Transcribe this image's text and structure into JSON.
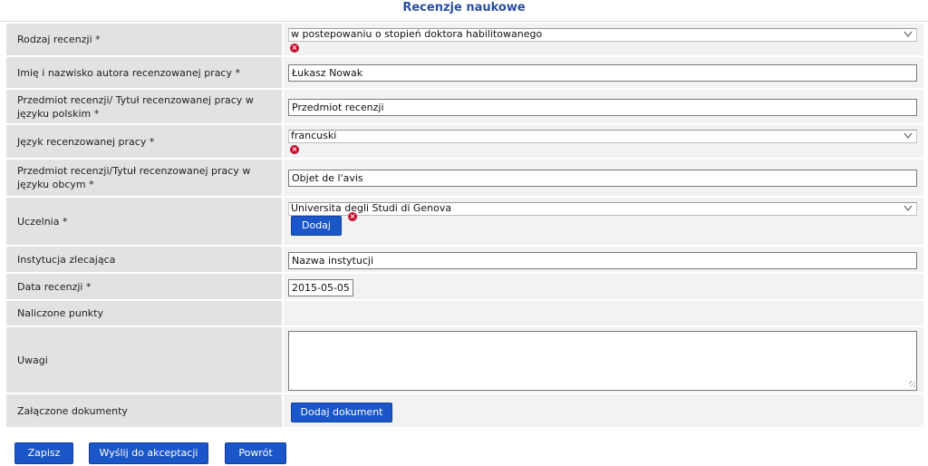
{
  "page": {
    "title": "Recenzje naukowe"
  },
  "form": {
    "review_type": {
      "label": "Rodzaj recenzji *",
      "value": "w postepowaniu o stopień doktora habilitowanego"
    },
    "author": {
      "label": "Imię i nazwisko autora recenzowanej pracy *",
      "value": "Łukasz Nowak"
    },
    "subject_pl": {
      "label": "Przedmiot recenzji/ Tytuł recenzowanej pracy w języku polskim *",
      "value": "Przedmiot recenzji"
    },
    "language": {
      "label": "Język recenzowanej pracy *",
      "value": "francuski"
    },
    "subject_foreign": {
      "label": "Przedmiot recenzji/Tytuł recenzowanej pracy w języku obcym *",
      "value": "Objet de l'avis"
    },
    "university": {
      "label": "Uczelnia *",
      "value": "Universita degli Studi di Genova",
      "add_label": "Dodaj"
    },
    "institution": {
      "label": "Instytucja zlecająca",
      "value": "Nazwa instytucji"
    },
    "review_date": {
      "label": "Data recenzji *",
      "value": "2015-05-05"
    },
    "points": {
      "label": "Naliczone punkty",
      "value": ""
    },
    "notes": {
      "label": "Uwagi",
      "value": ""
    },
    "documents": {
      "label": "Załączone dokumenty",
      "add_label": "Dodaj dokument"
    }
  },
  "actions": {
    "save": "Zapisz",
    "submit": "Wyślij do akceptacji",
    "back": "Powrót"
  },
  "colors": {
    "title": "#2b4f9e",
    "button": "#1a56c7",
    "error": "#c8102e",
    "label_bg": "#e2e2e2",
    "cell_bg": "#f2f2f2"
  },
  "icons": {
    "error": "error-x-icon",
    "dropdown": "chevron-down-icon"
  }
}
